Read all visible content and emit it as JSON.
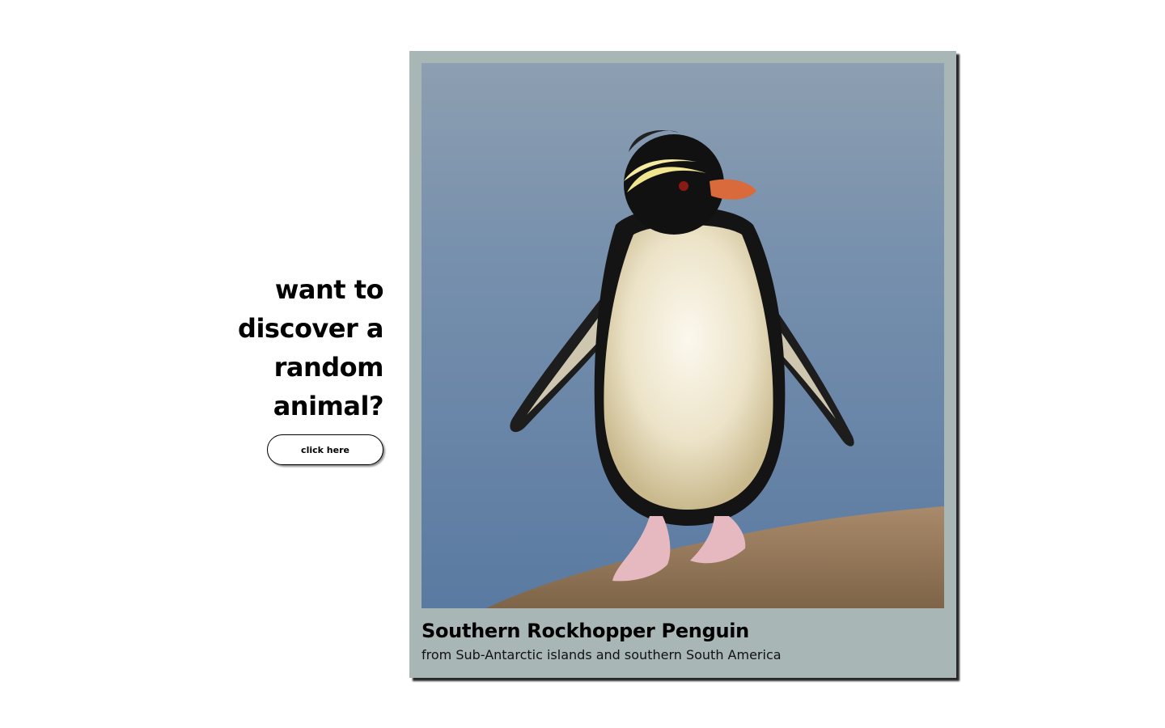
{
  "prompt": {
    "heading": "want to discover a random animal?",
    "button_label": "click here"
  },
  "card": {
    "animal_name": "Southern Rockhopper Penguin",
    "origin": "from Sub-Antarctic islands and southern South America",
    "photo_subject": "rockhopper-penguin-photo"
  },
  "colors": {
    "card_background": "#a8b6b5",
    "page_background": "#ffffff",
    "text": "#000000"
  }
}
